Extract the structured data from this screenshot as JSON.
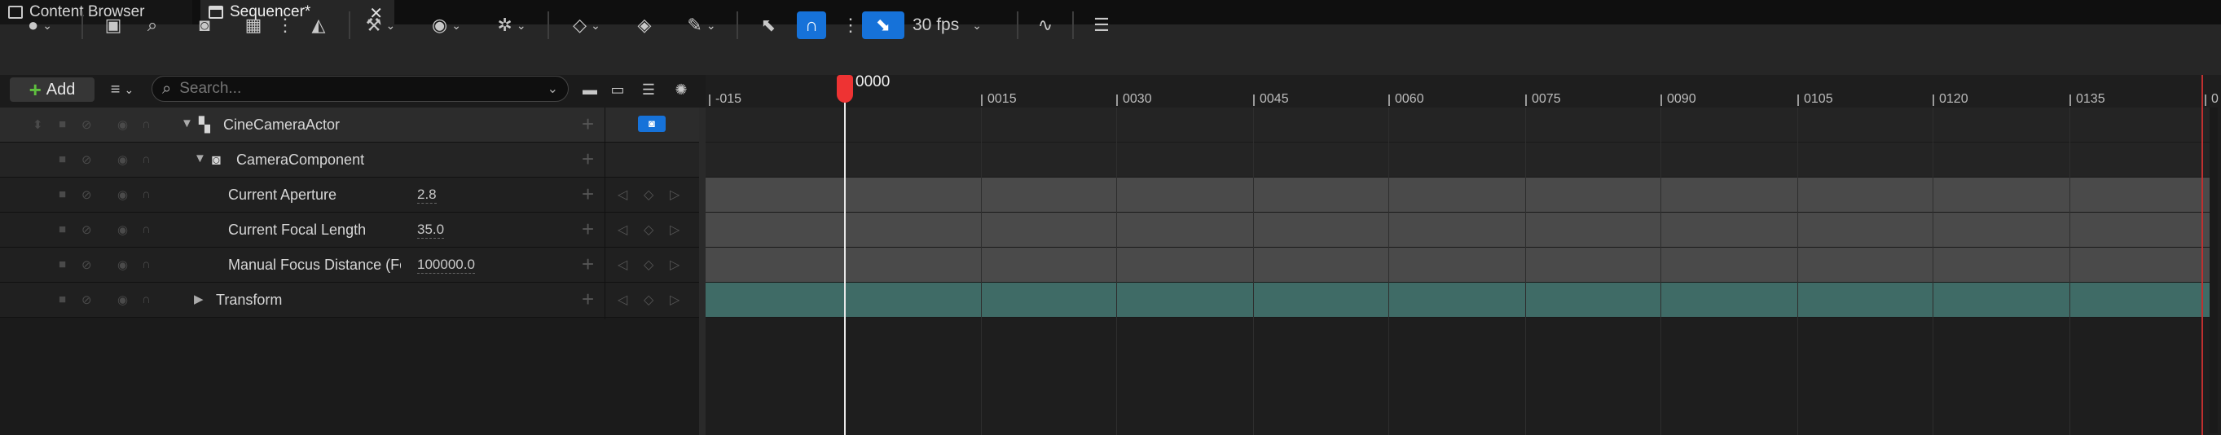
{
  "tabs": [
    {
      "label": "Content Browser",
      "icon": "content-browser-icon"
    },
    {
      "label": "Sequencer*",
      "icon": "clapperboard-icon",
      "close": "✕"
    }
  ],
  "toolbar": {
    "fps_label": "30 fps",
    "snap_active_color": "#1672d9"
  },
  "add_button": {
    "label": "Add"
  },
  "search": {
    "placeholder": "Search..."
  },
  "timeline": {
    "current_frame": "0000",
    "ticks": [
      "-015",
      "0015",
      "0030",
      "0045",
      "0060",
      "0075",
      "0090",
      "0105",
      "0120",
      "0135",
      "0"
    ]
  },
  "tree": {
    "rows": [
      {
        "label": "CineCameraActor",
        "icon": "actor-icon"
      },
      {
        "label": "CameraComponent",
        "icon": "camera-icon"
      },
      {
        "label": "Current Aperture",
        "value": "2.8"
      },
      {
        "label": "Current Focal Length",
        "value": "35.0"
      },
      {
        "label": "Manual Focus Distance (Fc",
        "value": "100000.0"
      },
      {
        "label": "Transform"
      }
    ]
  },
  "colors": {
    "playhead": "#e33333",
    "transform_track": "#3f6b66",
    "property_track": "#4a4a4a",
    "accent": "#1672d9"
  }
}
